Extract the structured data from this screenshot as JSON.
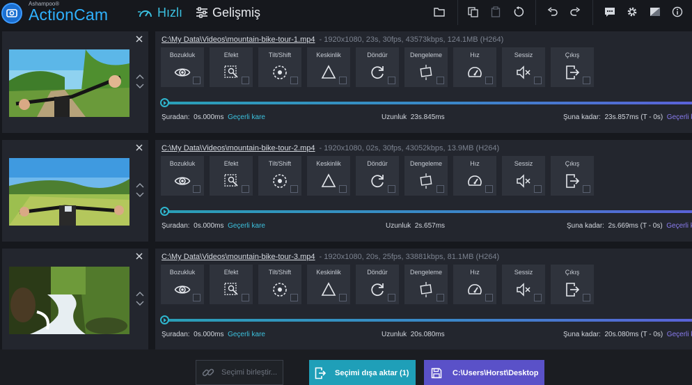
{
  "app": {
    "brand_small": "Ashampoo®",
    "brand_name": "ActionCam"
  },
  "modes": {
    "fast": "Hızlı",
    "advanced": "Gelişmiş"
  },
  "colors": {
    "accent_cyan": "#2fb7cf",
    "accent_purple": "#5a51c8",
    "brand_blue": "#2fb2ff"
  },
  "toolbar_icons": [
    "folder-open-icon",
    "copy-icon",
    "paste-icon",
    "reset-icon",
    "undo-icon",
    "redo-icon",
    "feedback-icon",
    "settings-gear-icon",
    "display-icon",
    "info-icon"
  ],
  "effects": [
    {
      "label": "Bozukluk",
      "icon": "eye-icon"
    },
    {
      "label": "Efekt",
      "icon": "effect-icon"
    },
    {
      "label": "Tilt/Shift",
      "icon": "tilt-shift-icon"
    },
    {
      "label": "Keskinlik",
      "icon": "sharpness-icon"
    },
    {
      "label": "Döndür",
      "icon": "rotate-icon"
    },
    {
      "label": "Dengeleme",
      "icon": "stabilize-icon"
    },
    {
      "label": "Hız",
      "icon": "speed-icon"
    },
    {
      "label": "Sessiz",
      "icon": "mute-icon"
    },
    {
      "label": "Çıkış",
      "icon": "exit-icon"
    }
  ],
  "clips": [
    {
      "path": "C:\\My Data\\Videos\\mountain-bike-tour-1.mp4",
      "meta": "-   1920x1080, 23s, 30fps, 43573kbps, 124.1MB (H264)",
      "from_label": "Şuradan:",
      "from_value": "0s.000ms",
      "current_frame": "Geçerli kare",
      "length_label": "Uzunluk",
      "length_value": "23s.845ms",
      "to_label": "Şuna kadar:",
      "to_value": "23s.857ms (T - 0s)",
      "to_link": "Geçerli kare",
      "playhead": 0
    },
    {
      "path": "C:\\My Data\\Videos\\mountain-bike-tour-2.mp4",
      "meta": "-   1920x1080, 02s, 30fps, 43052kbps, 13.9MB (H264)",
      "from_label": "Şuradan:",
      "from_value": "0s.000ms",
      "current_frame": "Geçerli kare",
      "length_label": "Uzunluk",
      "length_value": "2s.657ms",
      "to_label": "Şuna kadar:",
      "to_value": "2s.669ms (T - 0s)",
      "to_link": "Geçerli kare",
      "playhead": 0
    },
    {
      "path": "C:\\My Data\\Videos\\mountain-bike-tour-3.mp4",
      "meta": "-   1920x1080, 20s, 25fps, 33881kbps, 81.1MB (H264)",
      "from_label": "Şuradan:",
      "from_value": "0s.000ms",
      "current_frame": "Geçerli kare",
      "length_label": "Uzunluk",
      "length_value": "20s.080ms",
      "to_label": "Şuna kadar:",
      "to_value": "20s.080ms (T - 0s)",
      "to_link": "Geçerli kare",
      "playhead": 0
    }
  ],
  "footer": {
    "merge_label": "Seçimi birleştir...",
    "export_label": "Seçimi dışa aktar (1)",
    "folder_label": "C:\\Users\\Horst\\Desktop"
  }
}
